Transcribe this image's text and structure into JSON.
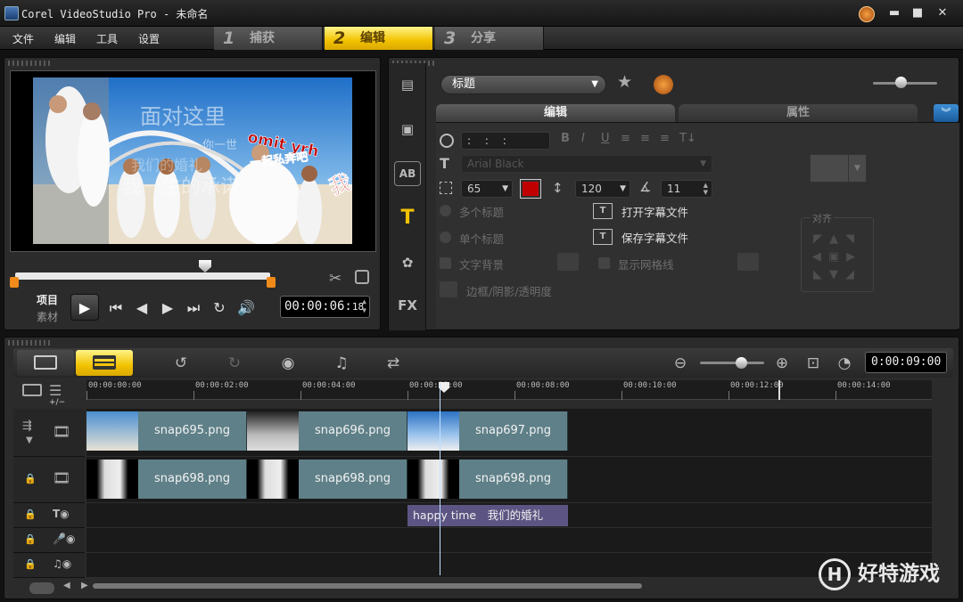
{
  "window": {
    "title": "Corel VideoStudio Pro - 未命名",
    "controls": {
      "minimize": "▬",
      "maximize": "■",
      "close": "✕"
    }
  },
  "menu": {
    "file": "文件",
    "edit": "编辑",
    "tools": "工具",
    "settings": "设置"
  },
  "steps": [
    {
      "num": "1",
      "label": "捕获"
    },
    {
      "num": "2",
      "label": "编辑"
    },
    {
      "num": "3",
      "label": "分享"
    }
  ],
  "preview": {
    "project_label": "项目",
    "clip_label": "素材",
    "timecode": "00:00:06:",
    "timecode_frames": "18",
    "image_text": {
      "line1": "面对这里",
      "line2": "你一世",
      "line3": "我一生的承诺",
      "line4": "我们的婚礼",
      "sticker1": "omit yrh",
      "sticker2": "一起私奔吧",
      "sticker3": "我"
    }
  },
  "options": {
    "category": "标题",
    "tabs": {
      "edit": "编辑",
      "attributes": "属性"
    },
    "duration_value": ": : :",
    "font_name": "Arial Black",
    "font_size": "65",
    "line_spacing": "120",
    "angle": "11",
    "multi_title": "多个标题",
    "single_title": "单个标题",
    "text_background": "文字背景",
    "show_grid": "显示网格线",
    "border_shadow": "边框/阴影/透明度",
    "open_subtitle": "打开字幕文件",
    "save_subtitle": "保存字幕文件",
    "align_label": "对齐",
    "text_color": "#c00000"
  },
  "timeline": {
    "timecode": "0:00:09:00",
    "ruler": [
      "00:00:00:00",
      "00:00:02:00",
      "00:00:04:00",
      "00:00:06:00",
      "00:00:08:00",
      "00:00:10:00",
      "00:00:12:00",
      "00:00:14:00"
    ],
    "video_track": [
      "snap695.png",
      "snap696.png",
      "snap697.png"
    ],
    "overlay_track": [
      "snap698.png",
      "snap698.png",
      "snap698.png"
    ],
    "title_clip": "happy time　我们的婚礼",
    "add_remove": "+/−"
  },
  "watermark": {
    "text": "好特游戏",
    "logo": "H"
  }
}
